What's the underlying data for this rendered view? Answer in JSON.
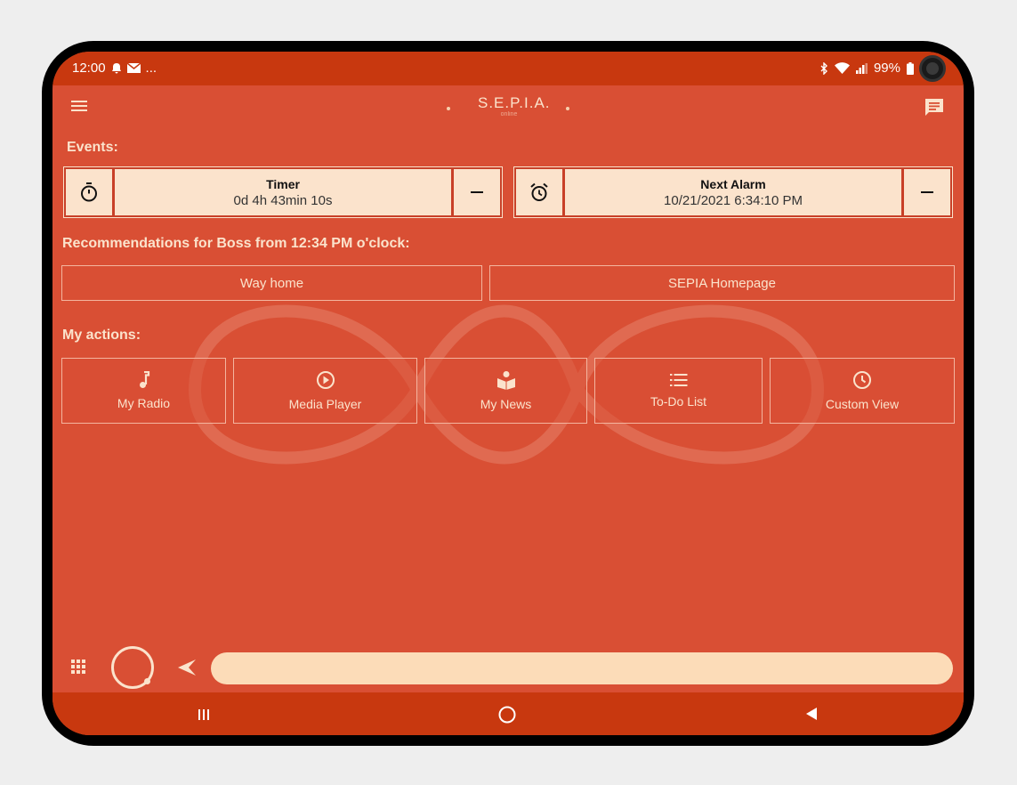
{
  "status_bar": {
    "time": "12:00",
    "more": "...",
    "battery": "99%"
  },
  "header": {
    "logo_title": "S.E.P.I.A.",
    "logo_subtitle": "online"
  },
  "events": {
    "title": "Events:",
    "items": [
      {
        "icon": "stopwatch-icon",
        "title": "Timer",
        "value": "0d 4h 43min 10s"
      },
      {
        "icon": "alarm-clock-icon",
        "title": "Next Alarm",
        "value": "10/21/2021 6:34:10 PM"
      }
    ]
  },
  "recommendations": {
    "title": "Recommendations for Boss from 12:34 PM o'clock:",
    "items": [
      "Way home",
      "SEPIA Homepage"
    ]
  },
  "actions": {
    "title": "My actions:",
    "items": [
      {
        "label": "My Radio",
        "icon": "music-note-icon"
      },
      {
        "label": "Media Player",
        "icon": "play-circle-icon"
      },
      {
        "label": "My News",
        "icon": "news-reader-icon"
      },
      {
        "label": "To-Do List",
        "icon": "list-icon"
      },
      {
        "label": "Custom View",
        "icon": "clock-icon"
      }
    ]
  },
  "input": {
    "value": "",
    "placeholder": ""
  },
  "colors": {
    "accent": "#d94f34",
    "bar": "#c8380f",
    "cream": "#fbe3cc",
    "input_bg": "#fcdcb8"
  }
}
